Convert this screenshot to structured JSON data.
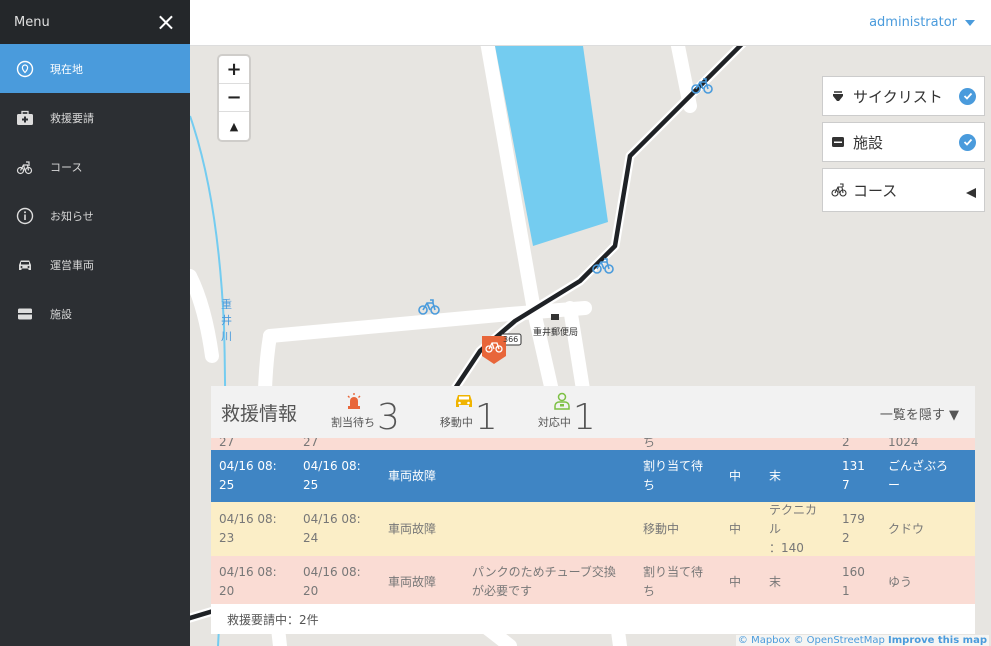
{
  "sidebar": {
    "menu_title": "Menu",
    "close_icon": "×",
    "items": [
      {
        "label": "現在地",
        "icon": "location-icon"
      },
      {
        "label": "救援要請",
        "icon": "medkit-icon"
      },
      {
        "label": "コース",
        "icon": "course-icon"
      },
      {
        "label": "お知らせ",
        "icon": "info-icon"
      },
      {
        "label": "運営車両",
        "icon": "car-icon"
      },
      {
        "label": "施設",
        "icon": "facility-icon"
      }
    ]
  },
  "topbar": {
    "user": "administrator"
  },
  "map": {
    "zoom_in": "+",
    "zoom_out": "−",
    "compass": "▲",
    "layers": [
      {
        "label": "サイクリスト",
        "icon": "cyclist-icon",
        "checked": true
      },
      {
        "label": "施設",
        "icon": "facility-icon",
        "checked": true
      },
      {
        "label": "コース",
        "icon": "course-icon",
        "checked": false
      }
    ],
    "labels": {
      "post_office": "重井郵便局",
      "river": "重井川",
      "route": "366"
    },
    "attribution": {
      "mapbox": "© Mapbox",
      "osm": "© OpenStreetMap",
      "improve": "Improve this map"
    }
  },
  "rescue": {
    "title": "救援情報",
    "stats": [
      {
        "label": "割当待ち",
        "count": "3",
        "icon": "siren-icon",
        "color": "#e8663a"
      },
      {
        "label": "移動中",
        "count": "1",
        "icon": "car-icon",
        "color": "#f0b400"
      },
      {
        "label": "対応中",
        "count": "1",
        "icon": "staff-icon",
        "color": "#7cc043"
      }
    ],
    "hide_list": "一覧を隠す ▼",
    "rows": [
      {
        "style": "pink",
        "cells": [
          "27",
          "27",
          "",
          "",
          "ち",
          "",
          "",
          "2",
          "1024"
        ]
      },
      {
        "style": "blue",
        "cells": [
          "04/16 08:\n25",
          "04/16 08:\n25",
          "車両故障",
          "",
          "割り当て待\nち",
          "中",
          "末",
          "131\n7",
          "ごんざぶろ\nー"
        ]
      },
      {
        "style": "yellow",
        "cells": [
          "04/16 08:\n23",
          "04/16 08:\n24",
          "車両故障",
          "",
          "移動中",
          "中",
          "テクニカル\n：140",
          "179\n2",
          "クドウ"
        ]
      },
      {
        "style": "pink",
        "cells": [
          "04/16 08:\n20",
          "04/16 08:\n20",
          "車両故障",
          "パンクのためチューブ交換\nが必要です",
          "割り当て待\nち",
          "中",
          "末",
          "160\n1",
          "ゆう"
        ]
      }
    ],
    "footer": "救援要請中：2件"
  },
  "colors": {
    "accent": "#4a9bdc",
    "sidebar_bg": "#2c2f33",
    "row_blue": "#3f85c4",
    "row_pink": "#fadcd4",
    "row_yellow": "#fbeec7"
  }
}
